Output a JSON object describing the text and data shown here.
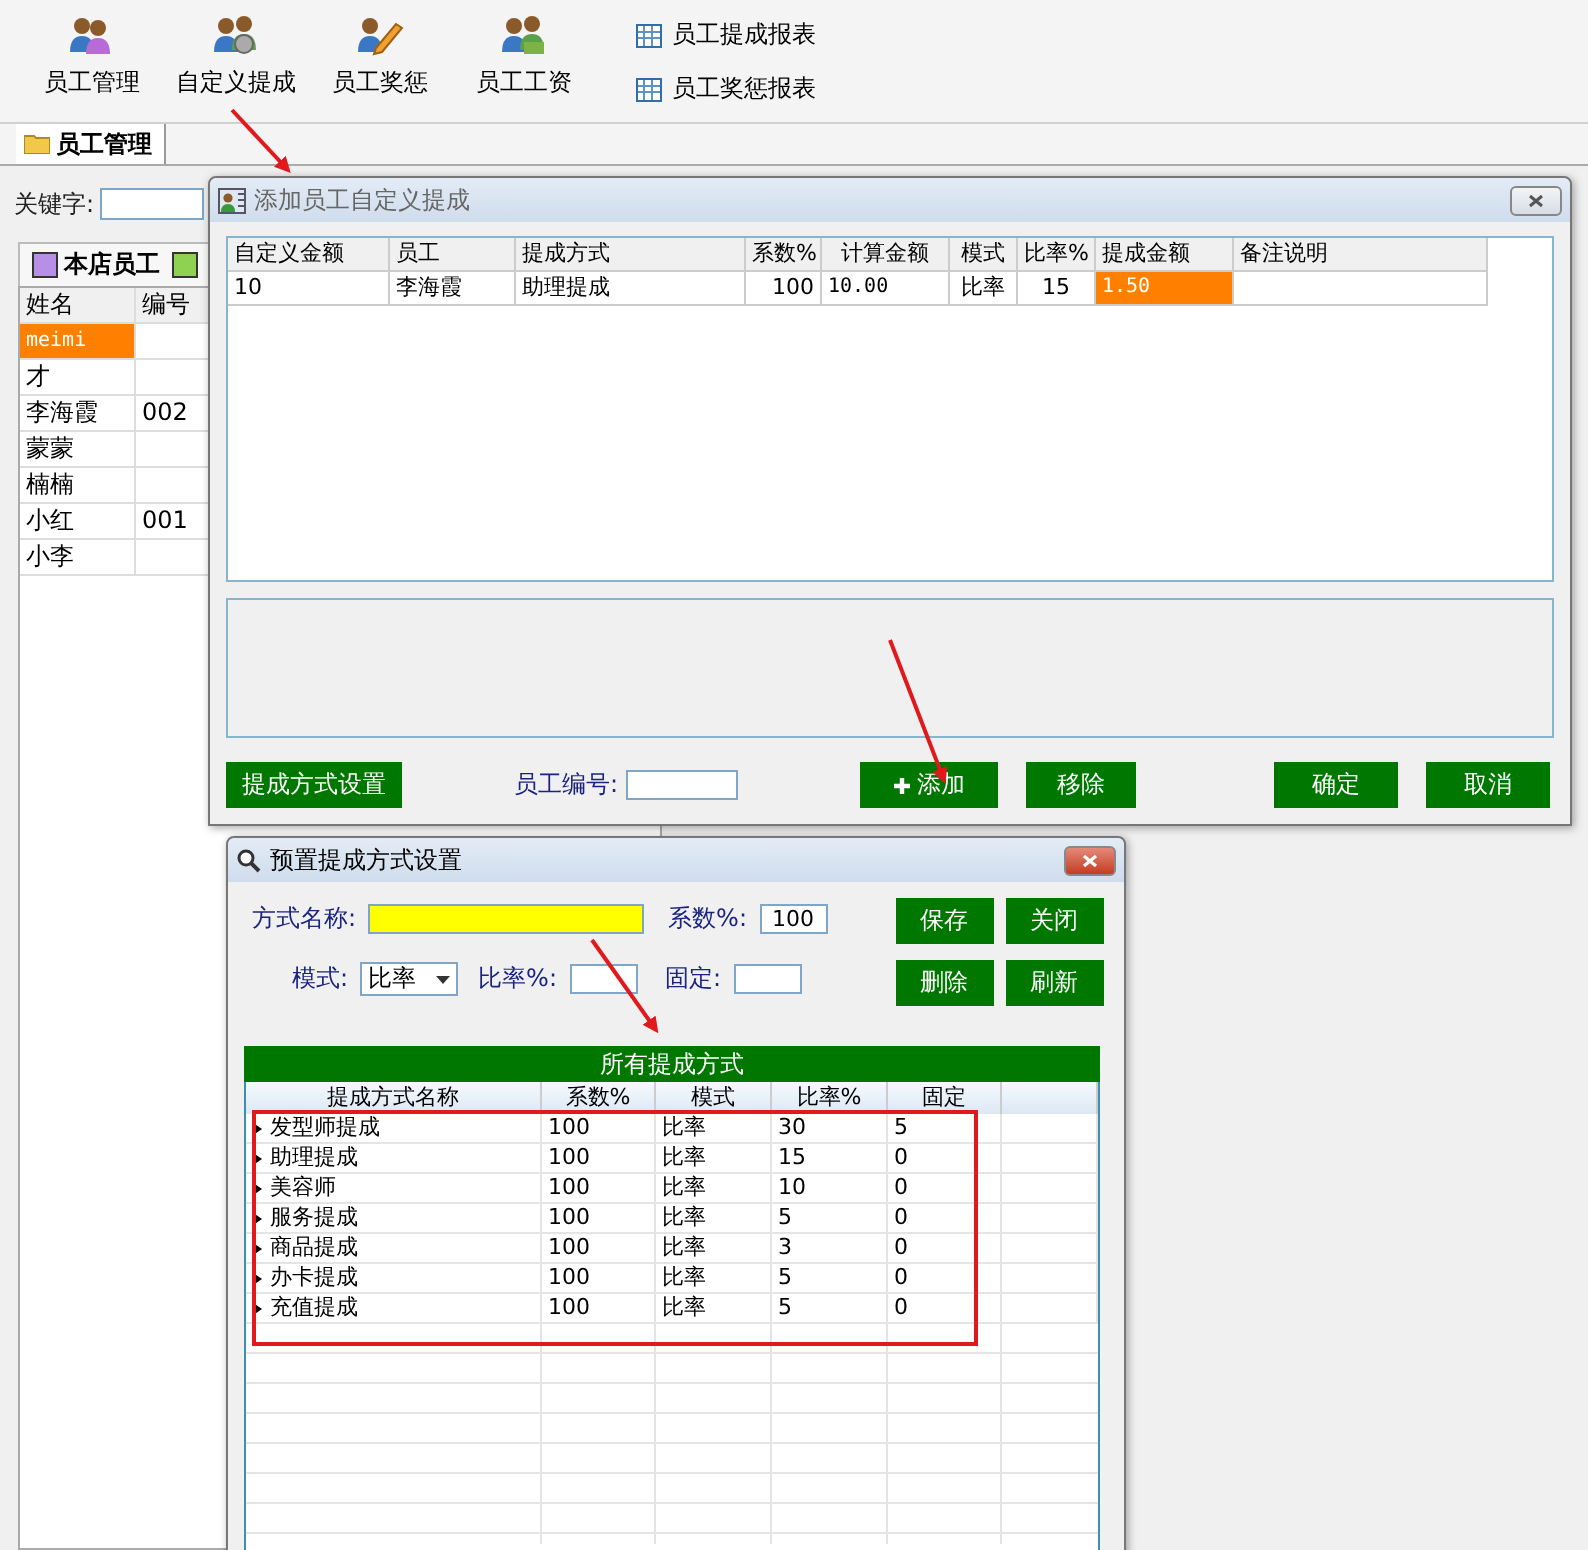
{
  "toolbar": {
    "buttons": [
      {
        "label": "员工管理",
        "kind": "people"
      },
      {
        "label": "自定义提成",
        "kind": "gear"
      },
      {
        "label": "员工奖惩",
        "kind": "pencil"
      },
      {
        "label": "员工工资",
        "kind": "money"
      }
    ],
    "reports": [
      "员工提成报表",
      "员工奖惩报表"
    ]
  },
  "tabs": [
    {
      "label": "员工管理",
      "selected": true
    }
  ],
  "search": {
    "label": "关键字:"
  },
  "groups": [
    {
      "label": "本店员工",
      "color": "#b88fe6"
    },
    {
      "color": "#8fd150"
    }
  ],
  "staff_table": {
    "columns": [
      "姓名",
      "编号"
    ],
    "rows": [
      {
        "name": "meimi",
        "selected": true
      },
      {
        "name": "才",
        "selected": false
      },
      {
        "name": "李海霞",
        "code": "002",
        "selected": false
      },
      {
        "name": "蒙蒙",
        "selected": false
      },
      {
        "name": "楠楠",
        "selected": false
      },
      {
        "name": "小红",
        "code": "001",
        "selected": false
      },
      {
        "name": "小李",
        "selected": false
      }
    ]
  },
  "custom_dialog": {
    "title": "添加员工自定义提成",
    "columns": [
      "自定义金额",
      "员工",
      "提成方式",
      "系数%",
      "计算金额",
      "模式",
      "比率%",
      "提成金额",
      "备注说明"
    ],
    "rows": [
      {
        "cells": [
          {
            "text": "10",
            "highlighted": false
          },
          {
            "text": "李海霞",
            "highlighted": false
          },
          {
            "text": "助理提成",
            "highlighted": false
          },
          {
            "text": "100",
            "highlighted": false
          },
          {
            "text": "10.00",
            "highlighted": false
          },
          {
            "text": "比率",
            "highlighted": false
          },
          {
            "text": "15",
            "highlighted": false
          },
          {
            "text": "1.50",
            "highlighted": true
          },
          {
            "text": "",
            "highlighted": false
          }
        ]
      }
    ],
    "settings_button": "提成方式设置",
    "employee_no_label": "员工编号:",
    "buttons": [
      {
        "label": "添加",
        "kind": "add"
      },
      {
        "label": "移除",
        "kind": "plain"
      },
      {
        "label": "确定",
        "kind": "plain"
      },
      {
        "label": "取消",
        "kind": "plain"
      }
    ]
  },
  "preset_dialog": {
    "title": "预置提成方式设置",
    "name_label": "方式名称:",
    "coef_label": "系数%:",
    "coef_value": "100",
    "mode_label": "模式:",
    "mode_value": "比率",
    "rate_label": "比率%:",
    "fixed_label": "固定:",
    "buttons": [
      "保存",
      "关闭",
      "删除",
      "刷新"
    ],
    "grid_title": "所有提成方式",
    "columns": [
      "提成方式名称",
      "系数%",
      "模式",
      "比率%",
      "固定"
    ],
    "rows": [
      [
        "发型师提成",
        "100",
        "比率",
        "30",
        "5"
      ],
      [
        "助理提成",
        "100",
        "比率",
        "15",
        "0"
      ],
      [
        "美容师",
        "100",
        "比率",
        "10",
        "0"
      ],
      [
        "服务提成",
        "100",
        "比率",
        "5",
        "0"
      ],
      [
        "商品提成",
        "100",
        "比率",
        "3",
        "0"
      ],
      [
        "办卡提成",
        "100",
        "比率",
        "5",
        "0"
      ],
      [
        "充值提成",
        "100",
        "比率",
        "5",
        "0"
      ]
    ]
  }
}
